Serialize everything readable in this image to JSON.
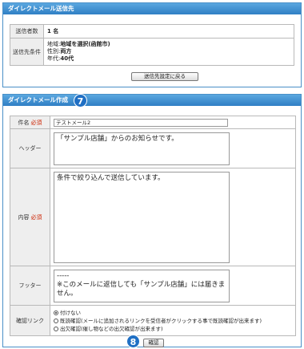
{
  "section1": {
    "title": "ダイレクトメール送信先",
    "count_label": "送信者数",
    "count_value": "1 名",
    "condition_label": "送信先条件",
    "conditions": [
      {
        "key": "地域:",
        "value": "地域を選択(函館市)"
      },
      {
        "key": "性別:",
        "value": "両方"
      },
      {
        "key": "年代:",
        "value": "40代"
      }
    ],
    "back_button": "送信先設定に戻る"
  },
  "section2": {
    "title": "ダイレクトメール作成",
    "badge_top": "7",
    "subject_label": "件名",
    "required": "必須",
    "subject_value": "テストメール2",
    "header_label": "ヘッダー",
    "header_text": "「サンプル店舗」からのお知らせです。",
    "body_label": "内容",
    "body_text": "条件で絞り込んで送信しています。",
    "footer_label": "フッター",
    "footer_line1": "-----",
    "footer_line2": "※このメールに返信しても「サンプル店舗」には届きません。",
    "confirm_link_label": "確認リンク",
    "options": [
      "付けない",
      "既読確認(メールに追加されるリンクを受信者がクリックする事で既読確認が出来ます)",
      "出欠確認(催し物などの出欠確認が出来ます)"
    ],
    "selected_option": 0,
    "confirm_button": "確認",
    "badge_bottom": "8"
  }
}
